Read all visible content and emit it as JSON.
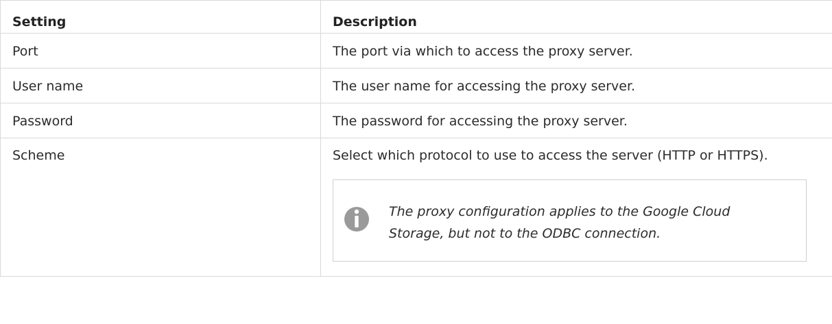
{
  "table": {
    "headers": [
      "Setting",
      "Description"
    ],
    "rows": [
      {
        "setting": "Port",
        "description": "The port via which to access the proxy server."
      },
      {
        "setting": "User name",
        "description": "The user name for accessing the proxy server."
      },
      {
        "setting": "Password",
        "description": "The password for accessing the proxy server."
      },
      {
        "setting": "Scheme",
        "description": "Select which protocol to use to access the server (HTTP or HTTPS)."
      }
    ]
  },
  "note": {
    "icon": "info-icon",
    "text": "The proxy configuration applies to the Google Cloud Storage, but not to the ODBC connection."
  },
  "colors": {
    "border": "#d9d9d9",
    "icon": "#9a9a9a",
    "text": "#2b2b2b"
  }
}
